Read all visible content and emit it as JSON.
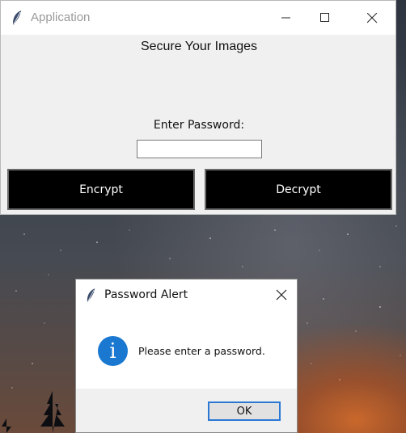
{
  "main_window": {
    "title": "Application",
    "heading": "Secure Your Images",
    "password_label": "Enter Password:",
    "password_value": "",
    "encrypt_label": "Encrypt",
    "decrypt_label": "Decrypt"
  },
  "dialog": {
    "title": "Password Alert",
    "message": "Please enter a password.",
    "ok_label": "OK",
    "icon": "info-icon"
  },
  "colors": {
    "button_bg": "#000000",
    "info_blue": "#1a78d0",
    "focus_border": "#2b78d4"
  }
}
